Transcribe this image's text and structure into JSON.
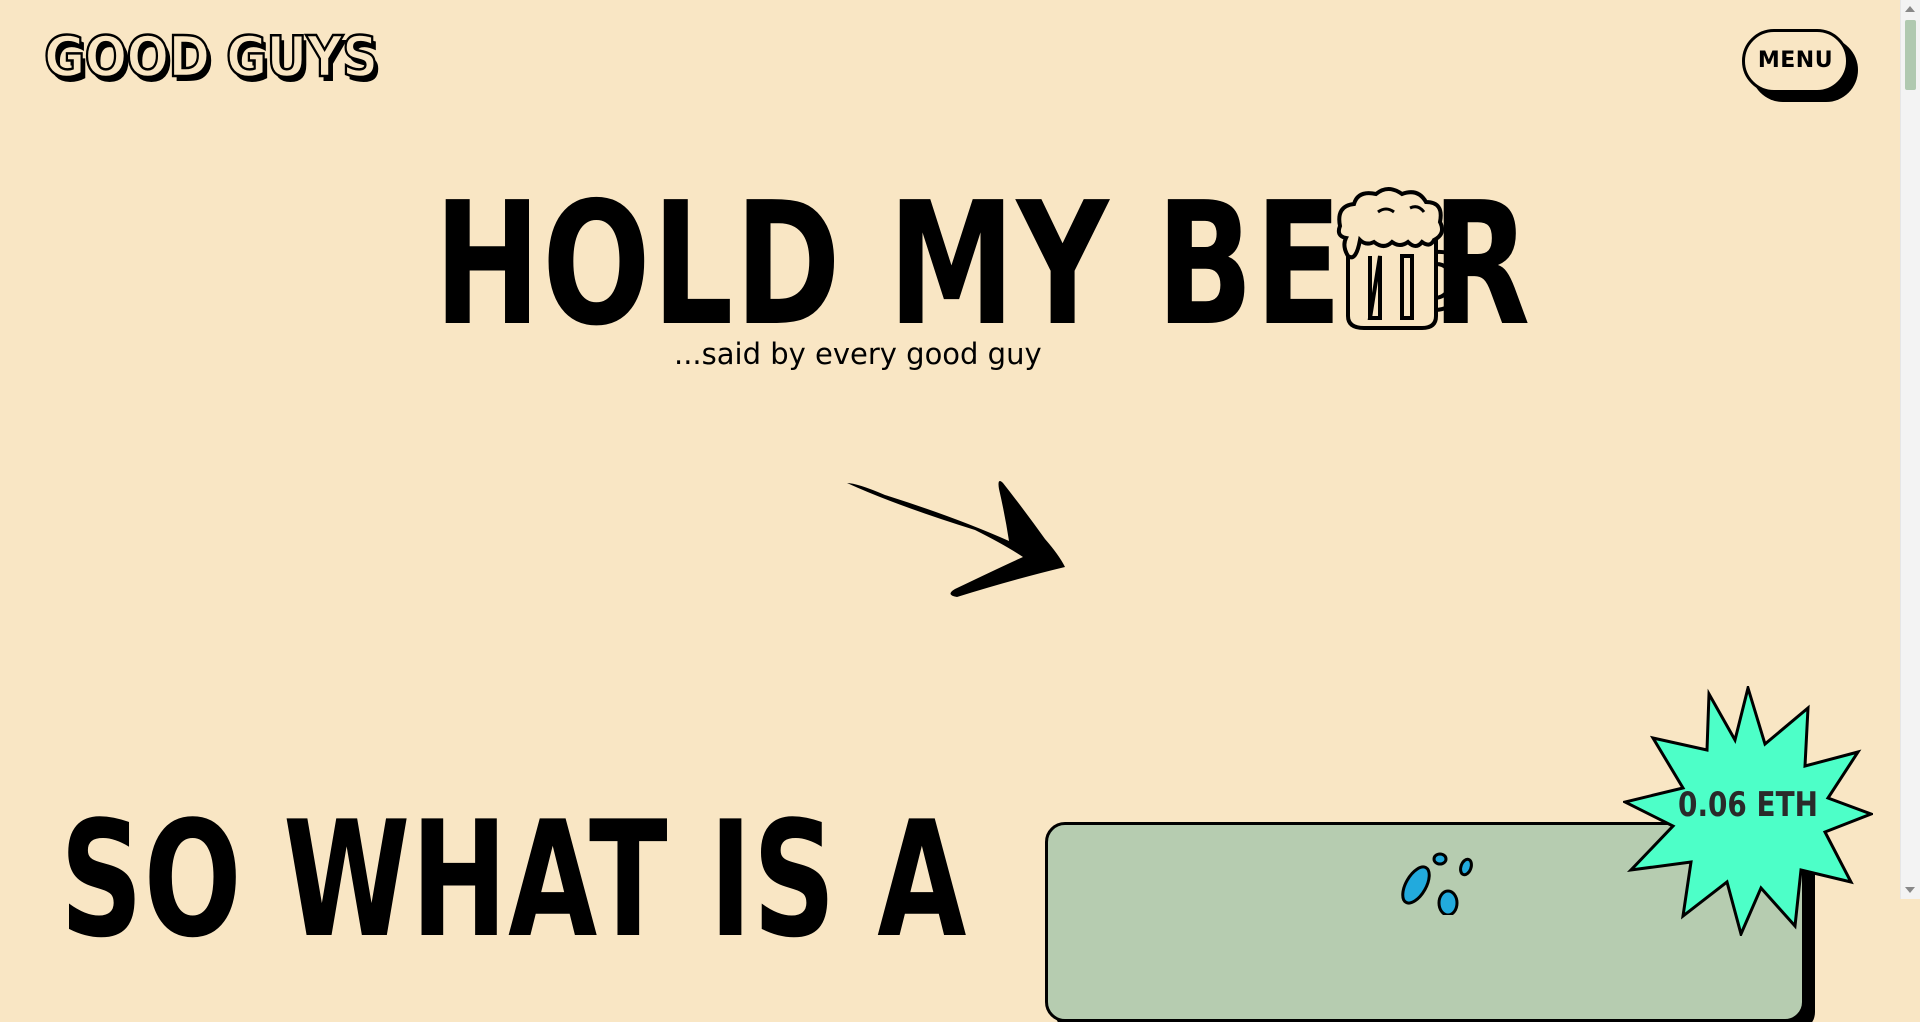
{
  "header": {
    "logo_text": "GOOD GUYS",
    "menu_label": "MENU"
  },
  "hero": {
    "title": "HOLD MY BEER",
    "subtitle": "...said by every good guy",
    "mug_icon": "beer-mug-icon",
    "arrow_icon": "arrow-right-icon"
  },
  "section": {
    "title": "SO WHAT IS A"
  },
  "price": {
    "label": "0.06 ETH",
    "color": "#4dffc8"
  },
  "colors": {
    "background": "#f9e6c4",
    "card": "#b6ccb0",
    "accent_blue": "#22aadd"
  }
}
